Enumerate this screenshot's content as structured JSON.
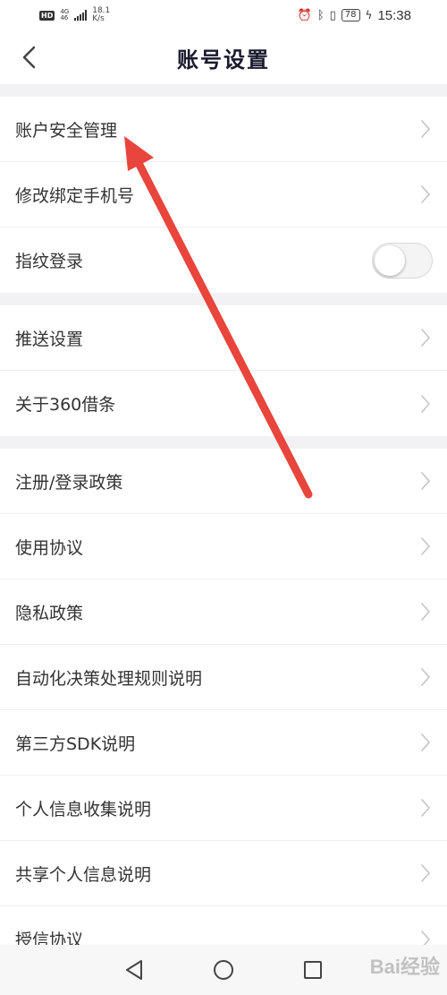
{
  "status_bar": {
    "hd": "HD",
    "net_top": "4G",
    "net_bottom": "46",
    "speed_value": "18.1",
    "speed_unit": "K/s",
    "battery": "78",
    "time": "15:38"
  },
  "header": {
    "title": "账号设置"
  },
  "groups": [
    {
      "items": [
        {
          "label": "账户安全管理",
          "control": "chevron"
        },
        {
          "label": "修改绑定手机号",
          "control": "chevron"
        },
        {
          "label": "指纹登录",
          "control": "toggle",
          "toggle_on": false
        }
      ]
    },
    {
      "items": [
        {
          "label": "推送设置",
          "control": "chevron"
        },
        {
          "label": "关于360借条",
          "control": "chevron"
        }
      ]
    },
    {
      "items": [
        {
          "label": "注册/登录政策",
          "control": "chevron"
        },
        {
          "label": "使用协议",
          "control": "chevron"
        },
        {
          "label": "隐私政策",
          "control": "chevron"
        },
        {
          "label": "自动化决策处理规则说明",
          "control": "chevron"
        },
        {
          "label": "第三方SDK说明",
          "control": "chevron"
        },
        {
          "label": "个人信息收集说明",
          "control": "chevron"
        },
        {
          "label": "共享个人信息说明",
          "control": "chevron"
        },
        {
          "label": "授信协议",
          "control": "chevron"
        }
      ]
    }
  ],
  "nav_bar": {
    "icons": [
      "back-triangle-icon",
      "home-circle-icon",
      "recents-square-icon"
    ]
  },
  "watermark": "Bai经验",
  "colors": {
    "annotation_arrow": "#e8453c",
    "group_gap": "#f2f2f4"
  }
}
